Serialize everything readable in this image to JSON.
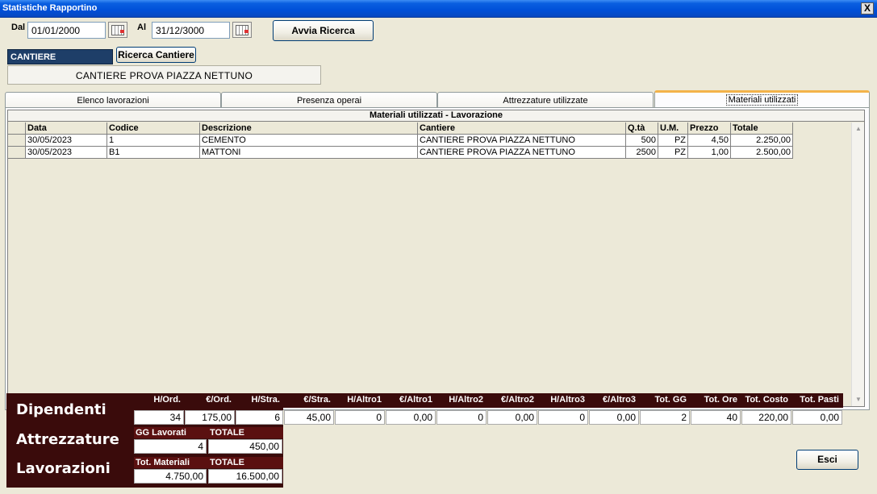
{
  "window": {
    "title": "Statistiche Rapportino",
    "close_glyph": "X"
  },
  "filters": {
    "dal_label": "Dal",
    "dal_value": "01/01/2000",
    "al_label": "Al",
    "al_value": "31/12/3000",
    "search_button": "Avvia Ricerca"
  },
  "cantiere": {
    "label": "CANTIERE",
    "search_button": "Ricerca Cantiere",
    "name": "CANTIERE PROVA PIAZZA NETTUNO"
  },
  "tabs": [
    {
      "label": "Elenco lavorazioni"
    },
    {
      "label": "Presenza operai"
    },
    {
      "label": "Attrezzature utilizzate"
    },
    {
      "label": "Materiali utilizzati"
    }
  ],
  "grid": {
    "caption": "Materiali utilizzati - Lavorazione",
    "columns": [
      "Data",
      "Codice",
      "Descrizione",
      "Cantiere",
      "Q.tà",
      "U.M.",
      "Prezzo",
      "Totale"
    ],
    "rows": [
      [
        "30/05/2023",
        "1",
        "CEMENTO",
        "CANTIERE PROVA PIAZZA NETTUNO",
        "500",
        "PZ",
        "4,50",
        "2.250,00"
      ],
      [
        "30/05/2023",
        "B1",
        "MATTONI",
        "CANTIERE PROVA PIAZZA NETTUNO",
        "2500",
        "PZ",
        "1,00",
        "2.500,00"
      ]
    ]
  },
  "summary": {
    "dipendenti_title": "Dipendenti",
    "attrezzature_title": "Attrezzature",
    "lavorazioni_title": "Lavorazioni",
    "dip_headers": [
      "H/Ord.",
      "€/Ord.",
      "H/Stra.",
      "€/Stra.",
      "H/Altro1",
      "€/Altro1",
      "H/Altro2",
      "€/Altro2",
      "H/Altro3",
      "€/Altro3",
      "Tot. GG",
      "Tot. Ore",
      "Tot. Costo",
      "Tot. Pasti"
    ],
    "dip_values": [
      "34",
      "175,00",
      "6",
      "45,00",
      "0",
      "0,00",
      "0",
      "0,00",
      "0",
      "0,00",
      "2",
      "40",
      "220,00",
      "0,00"
    ],
    "attr_headers": [
      "GG Lavorati",
      "TOTALE"
    ],
    "attr_values": [
      "4",
      "450,00"
    ],
    "lav_headers": [
      "Tot. Materiali",
      "TOTALE"
    ],
    "lav_values": [
      "4.750,00",
      "16.500,00"
    ]
  },
  "exit_button": "Esci"
}
